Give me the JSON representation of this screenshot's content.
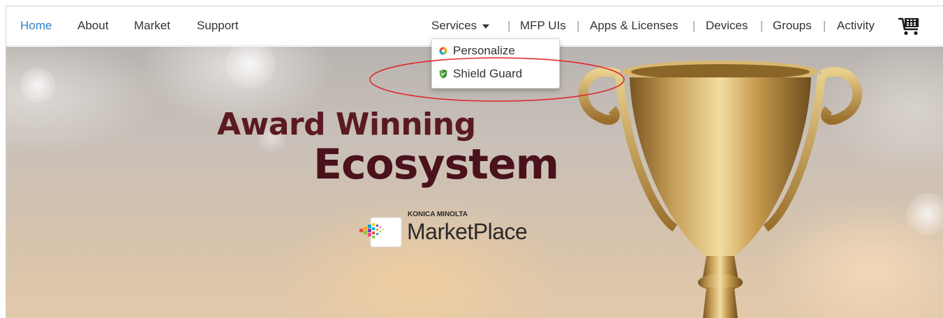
{
  "nav": {
    "left": [
      {
        "label": "Home",
        "active": true
      },
      {
        "label": "About"
      },
      {
        "label": "Market"
      },
      {
        "label": "Support"
      }
    ],
    "right": [
      {
        "label": "Services"
      },
      {
        "label": "MFP UIs"
      },
      {
        "label": "Apps & Licenses"
      },
      {
        "label": "Devices"
      },
      {
        "label": "Groups"
      },
      {
        "label": "Activity"
      }
    ],
    "separator": "|",
    "cart_icon": "shopping-cart-icon"
  },
  "dropdown": {
    "items": [
      {
        "label": "Personalize",
        "icon": "personalize-icon"
      },
      {
        "label": "Shield Guard",
        "icon": "shield-icon"
      }
    ]
  },
  "hero": {
    "line1": "Award Winning",
    "line2": "Ecosystem",
    "brand_small": "KONICA MINOLTA",
    "brand_big": "MarketPlace"
  },
  "colors": {
    "accent": "#2f7fc4",
    "headline": "#5b1a22",
    "highlight": "#e0282e"
  }
}
